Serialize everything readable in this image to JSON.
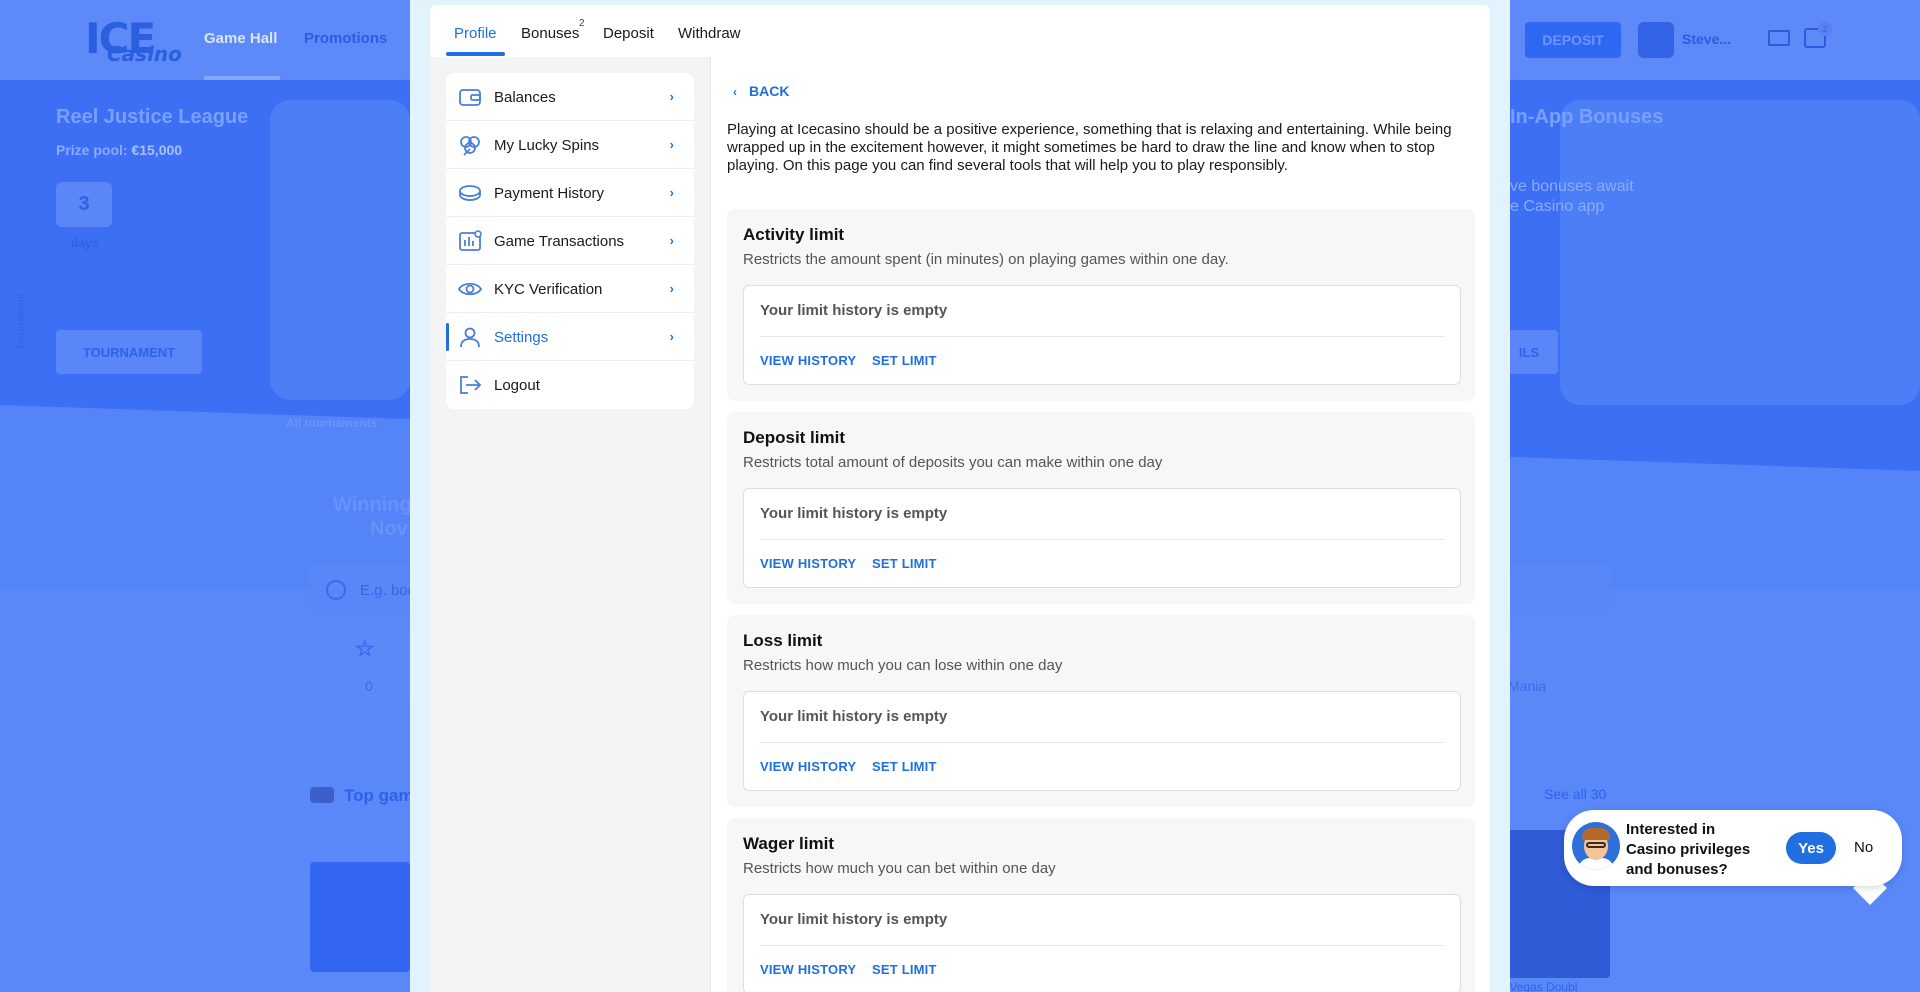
{
  "background": {
    "nav": {
      "game_hall": "Game Hall",
      "promotions": "Promotions"
    },
    "deposit_button": "DEPOSIT",
    "username": "Steve...",
    "gift_badge": "2",
    "tournament": {
      "title": "Reel Justice League",
      "prize_label": "Prize pool:",
      "prize_value": "€15,000",
      "days_value": "3",
      "days_label": "days",
      "button": "TOURNAMENT",
      "all_link": "All tournaments",
      "vertical_label": "Tournament"
    },
    "promo": {
      "title": "In-App Bonuses",
      "line1": "ve bonuses await",
      "line2": "e Casino app",
      "button": "ILS"
    },
    "winning_line1": "Winning",
    "winning_line2": "Nov",
    "search_placeholder": "E.g. boo",
    "favorites_count": "0",
    "mania_label": "Mania",
    "top_games": "Top gam",
    "see_all": "See all 30",
    "vegas_label": "s Vegas Doubl"
  },
  "tabs": [
    {
      "label": "Profile",
      "active": true
    },
    {
      "label": "Bonuses",
      "badge": "2"
    },
    {
      "label": "Deposit"
    },
    {
      "label": "Withdraw"
    }
  ],
  "menu": [
    {
      "label": "Balances",
      "icon": "wallet-icon"
    },
    {
      "label": "My Lucky Spins",
      "icon": "clover-icon"
    },
    {
      "label": "Payment History",
      "icon": "coins-icon"
    },
    {
      "label": "Game Transactions",
      "icon": "bar-chart-icon"
    },
    {
      "label": "KYC Verification",
      "icon": "eye-icon"
    },
    {
      "label": "Settings",
      "icon": "user-icon",
      "active": true
    },
    {
      "label": "Logout",
      "icon": "logout-icon"
    }
  ],
  "content": {
    "back": "BACK",
    "intro": "Playing at Icecasino should be a positive experience, something that is relaxing and entertaining. While being wrapped up in the excitement however, it might sometimes be hard to draw the line and know when to stop playing. On this page you can find several tools that will help you to play responsibly.",
    "limits": [
      {
        "title": "Activity limit",
        "description": "Restricts the amount spent (in minutes) on playing games within one day.",
        "empty": "Your limit history is empty",
        "view_history": "VIEW HISTORY",
        "set_limit": "SET LIMIT"
      },
      {
        "title": "Deposit limit",
        "description": "Restricts total amount of deposits you can make within one day",
        "empty": "Your limit history is empty",
        "view_history": "VIEW HISTORY",
        "set_limit": "SET LIMIT"
      },
      {
        "title": "Loss limit",
        "description": "Restricts how much you can lose within one day",
        "empty": "Your limit history is empty",
        "view_history": "VIEW HISTORY",
        "set_limit": "SET LIMIT"
      },
      {
        "title": "Wager limit",
        "description": "Restricts how much you can bet within one day",
        "empty": "Your limit history is empty",
        "view_history": "VIEW HISTORY",
        "set_limit": "SET LIMIT"
      }
    ]
  },
  "chat": {
    "text": "Interested in Casino privileges and bonuses?",
    "yes": "Yes",
    "no": "No"
  },
  "colors": {
    "accent": "#1f6fe0",
    "modal_frame": "#e3f3fd",
    "background_blue": "#4a7cf7"
  }
}
